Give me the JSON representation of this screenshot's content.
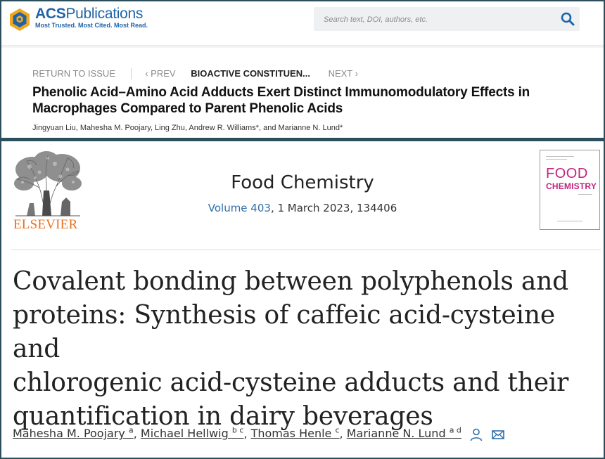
{
  "acs": {
    "brand_bold": "ACS",
    "brand_rest": "Publications",
    "tagline": "Most Trusted. Most Cited. Most Read.",
    "search_placeholder": "Search text, DOI, authors, etc.",
    "nav": {
      "return": "RETURN TO ISSUE",
      "prev": "‹ PREV",
      "current": "BIOACTIVE CONSTITUEN...",
      "next": "NEXT ›"
    },
    "title_line1": "Phenolic Acid–Amino Acid Adducts Exert Distinct Immunomodulatory Effects in",
    "title_line2": "Macrophages Compared to Parent Phenolic Acids",
    "authors": "Jingyuan Liu, Mahesha M. Poojary, Ling Zhu, Andrew R. Williams*, and Marianne N. Lund*"
  },
  "elsevier": {
    "publisher": "ELSEVIER",
    "journal": "Food Chemistry",
    "volume_link": "Volume 403",
    "volume_rest": ", 1 March 2023, 134406",
    "cover_food": "FOOD",
    "cover_chemistry": "CHEMISTRY",
    "title_lines": [
      "Covalent bonding between polyphenols and",
      "proteins: Synthesis of caffeic acid-cysteine and",
      "chlorogenic acid-cysteine adducts and their",
      "quantification in dairy beverages"
    ],
    "authors": [
      {
        "name": "Mahesha M. Poojary",
        "sup": "a"
      },
      {
        "name": "Michael Hellwig",
        "sup": "b c"
      },
      {
        "name": "Thomas Henle",
        "sup": "c"
      },
      {
        "name": "Marianne N. Lund",
        "sup": "a d"
      }
    ],
    "author_separator": ","
  },
  "colors": {
    "acs_blue": "#1f64a8",
    "elsevier_orange": "#e9711c",
    "link_blue": "#2f6fa8",
    "cover_magenta": "#c2237f",
    "frame": "#2c4f5e"
  },
  "icons": [
    "acs-hexagon-logo-icon",
    "search-icon",
    "elsevier-tree-logo-icon",
    "person-icon",
    "envelope-icon"
  ]
}
